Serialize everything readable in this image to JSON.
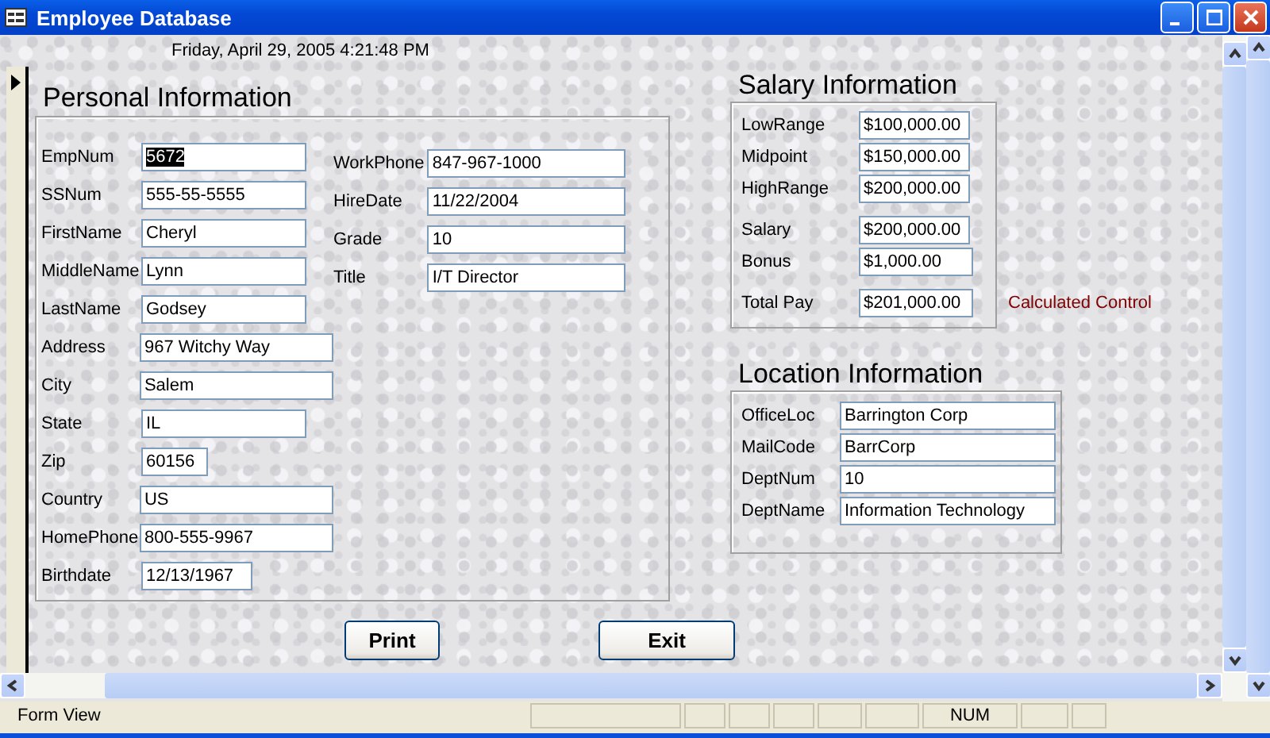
{
  "window": {
    "title": "Employee Database"
  },
  "form": {
    "timestamp": "Friday, April 29, 2005 4:21:48 PM",
    "personal": {
      "title": "Personal Information",
      "left_fields": [
        {
          "label": "EmpNum",
          "value": "5672",
          "text_selected": true
        },
        {
          "label": "SSNum",
          "value": "555-55-5555",
          "text_selected": false
        },
        {
          "label": "FirstName",
          "value": "Cheryl",
          "text_selected": false
        },
        {
          "label": "MiddleName",
          "value": "Lynn",
          "text_selected": false
        },
        {
          "label": "LastName",
          "value": "Godsey",
          "text_selected": false
        },
        {
          "label": "Address",
          "value": "967 Witchy Way",
          "text_selected": false
        },
        {
          "label": "City",
          "value": "Salem",
          "text_selected": false
        },
        {
          "label": "State",
          "value": "IL",
          "text_selected": false
        },
        {
          "label": "Zip",
          "value": "60156",
          "text_selected": false
        },
        {
          "label": "Country",
          "value": "US",
          "text_selected": false
        },
        {
          "label": "HomePhone",
          "value": "800-555-9967",
          "text_selected": false
        },
        {
          "label": "Birthdate",
          "value": "12/13/1967",
          "text_selected": false
        }
      ],
      "right_fields": [
        {
          "label": "WorkPhone",
          "value": "847-967-1000",
          "text_selected": false
        },
        {
          "label": "HireDate",
          "value": "11/22/2004",
          "text_selected": false
        },
        {
          "label": "Grade",
          "value": "10",
          "text_selected": false
        },
        {
          "label": "Title",
          "value": "I/T Director",
          "text_selected": false
        }
      ]
    },
    "salary": {
      "title": "Salary Information",
      "groups": [
        [
          {
            "label": "LowRange",
            "value": "$100,000.00"
          },
          {
            "label": "Midpoint",
            "value": "$150,000.00"
          },
          {
            "label": "HighRange",
            "value": "$200,000.00"
          }
        ],
        [
          {
            "label": "Salary",
            "value": "$200,000.00"
          },
          {
            "label": "Bonus",
            "value": "$1,000.00"
          }
        ],
        [
          {
            "label": "Total Pay",
            "value": "$201,000.00",
            "note": "Calculated Control"
          }
        ]
      ]
    },
    "location": {
      "title": "Location Information",
      "fields": [
        {
          "label": "OfficeLoc",
          "value": "Barrington Corp"
        },
        {
          "label": "MailCode",
          "value": "BarrCorp"
        },
        {
          "label": "DeptNum",
          "value": "10"
        },
        {
          "label": "DeptName",
          "value": "Information Technology"
        }
      ]
    },
    "buttons": [
      "Print",
      "Exit"
    ]
  },
  "status_bar": {
    "mode": "Form View",
    "num": "NUM"
  }
}
